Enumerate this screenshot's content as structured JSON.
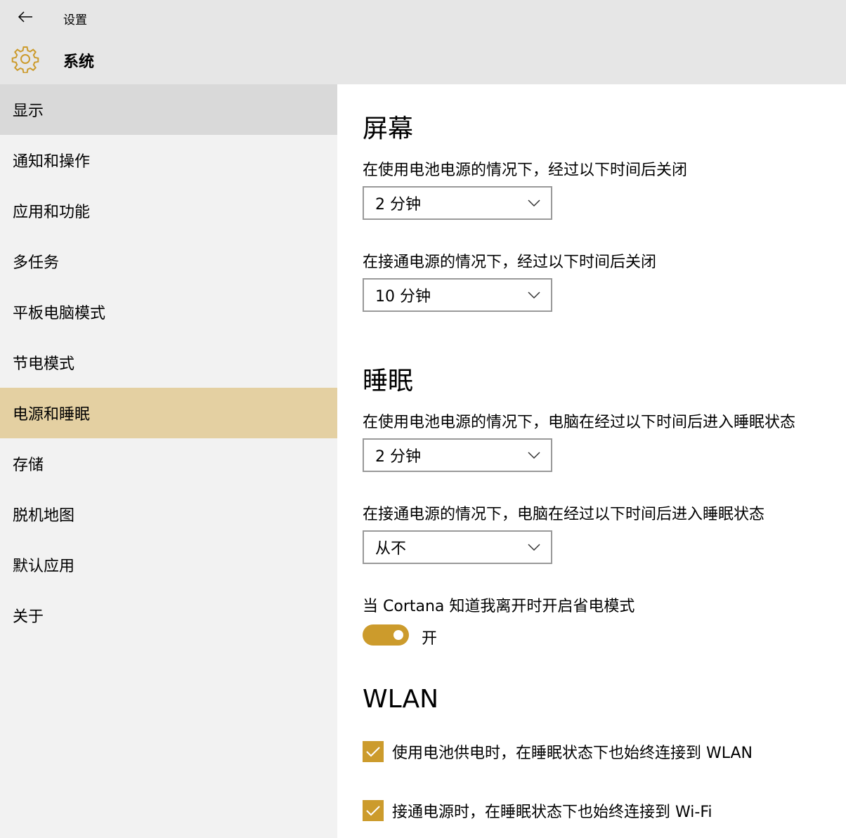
{
  "header": {
    "app_title": "设置",
    "section_title": "系统",
    "back_icon": "arrow-left-icon",
    "section_icon": "gear-icon",
    "accent_color": "#cc9b2c"
  },
  "sidebar": {
    "items": [
      {
        "label": "显示",
        "state": "hover"
      },
      {
        "label": "通知和操作",
        "state": "normal"
      },
      {
        "label": "应用和功能",
        "state": "normal"
      },
      {
        "label": "多任务",
        "state": "normal"
      },
      {
        "label": "平板电脑模式",
        "state": "normal"
      },
      {
        "label": "节电模式",
        "state": "normal"
      },
      {
        "label": "电源和睡眠",
        "state": "selected"
      },
      {
        "label": "存储",
        "state": "normal"
      },
      {
        "label": "脱机地图",
        "state": "normal"
      },
      {
        "label": "默认应用",
        "state": "normal"
      },
      {
        "label": "关于",
        "state": "normal"
      }
    ]
  },
  "screen": {
    "heading": "屏幕",
    "battery_label": "在使用电池电源的情况下，经过以下时间后关闭",
    "battery_value": "2 分钟",
    "plugged_label": "在接通电源的情况下，经过以下时间后关闭",
    "plugged_value": "10 分钟"
  },
  "sleep": {
    "heading": "睡眠",
    "battery_label": "在使用电池电源的情况下，电脑在经过以下时间后进入睡眠状态",
    "battery_value": "2 分钟",
    "plugged_label": "在接通电源的情况下，电脑在经过以下时间后进入睡眠状态",
    "plugged_value": "从不",
    "cortana_label": "当 Cortana 知道我离开时开启省电模式",
    "cortana_toggle": "开"
  },
  "wlan": {
    "heading": "WLAN",
    "battery_check_label": "使用电池供电时，在睡眠状态下也始终连接到 WLAN",
    "battery_checked": true,
    "plugged_check_label": "接通电源时，在睡眠状态下也始终连接到 Wi-Fi",
    "plugged_checked": true
  }
}
